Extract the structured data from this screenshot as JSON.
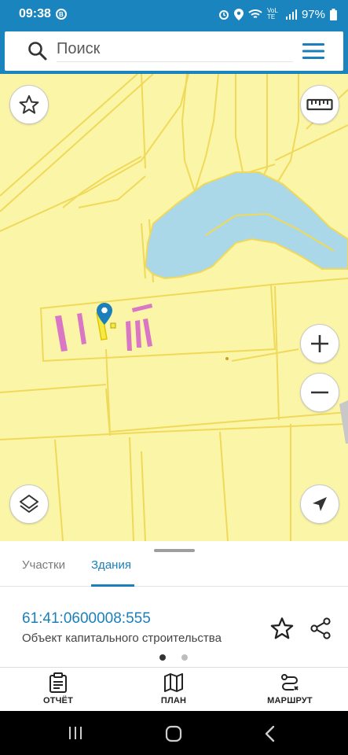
{
  "status_bar": {
    "time": "09:38",
    "notification_badge": "B",
    "network": "VoLTE",
    "battery": "97%"
  },
  "search": {
    "placeholder": "Поиск"
  },
  "map": {
    "colors": {
      "land": "#fbf5a7",
      "parcel_outline": "#f0d95a",
      "water": "#aad8e8",
      "building": "#d977c4",
      "marker": "#1a7fba"
    }
  },
  "panel": {
    "tabs": [
      {
        "label": "Участки",
        "active": false
      },
      {
        "label": "Здания",
        "active": true
      }
    ],
    "object": {
      "cadastral_number": "61:41:0600008:555",
      "type": "Объект капитального строительства"
    },
    "pager": {
      "count": 2,
      "active": 0
    }
  },
  "bottom_nav": {
    "items": [
      {
        "label": "ОТЧЁТ",
        "icon": "clipboard-icon"
      },
      {
        "label": "ПЛАН",
        "icon": "map-icon"
      },
      {
        "label": "МАРШРУТ",
        "icon": "route-icon"
      }
    ]
  },
  "accent_color": "#1a84bf"
}
